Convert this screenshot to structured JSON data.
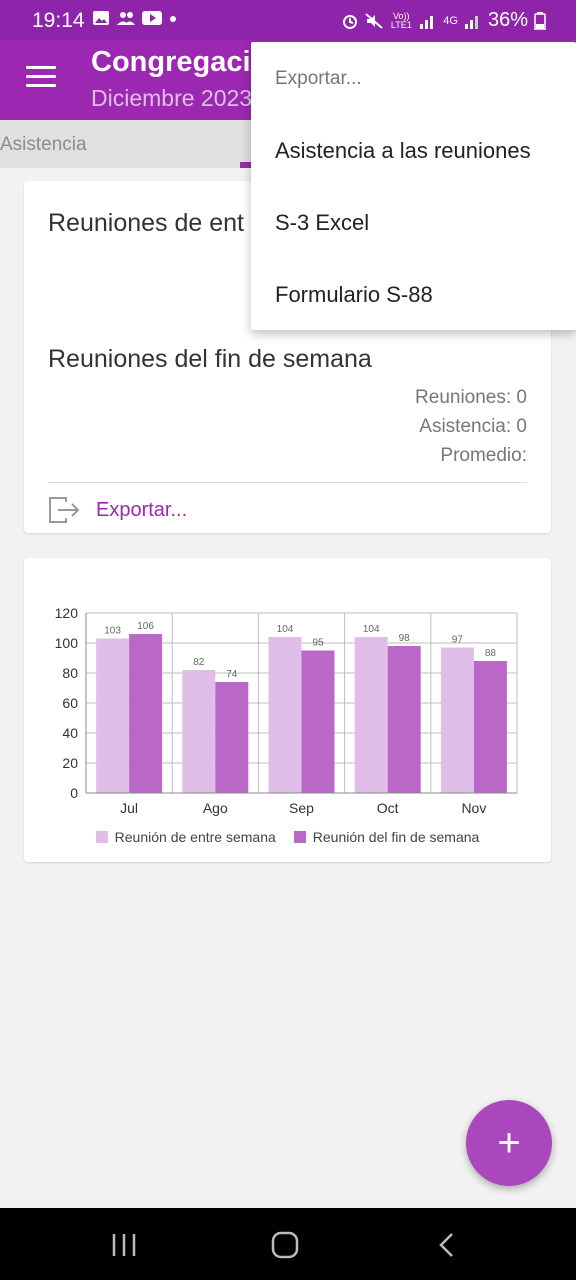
{
  "status_bar": {
    "time": "19:14",
    "battery": "36%",
    "network": "4G",
    "volte": "Vo)) LTE1"
  },
  "app_bar": {
    "title": "Congregacio",
    "subtitle": "Diciembre 2023",
    "color": "#9c27b0"
  },
  "tabs": [
    {
      "label": "Asistencia"
    }
  ],
  "summary_card": {
    "midweek_title": "Reuniones de ent",
    "weekend_title": "Reuniones del fin de semana",
    "meetings": "Reuniones: 0",
    "attendance": "Asistencia: 0",
    "average": "Promedio:",
    "export_label": "Exportar..."
  },
  "export_menu": {
    "header": "Exportar...",
    "items": [
      {
        "label": "Asistencia a las reuniones"
      },
      {
        "label": "S-3 Excel"
      },
      {
        "label": "Formulario S-88"
      }
    ]
  },
  "chart_data": {
    "type": "bar",
    "categories": [
      "Jul",
      "Ago",
      "Sep",
      "Oct",
      "Nov"
    ],
    "series": [
      {
        "name": "Reunión de entre semana",
        "values": [
          103,
          82,
          104,
          104,
          97
        ],
        "color": "#e1bee7"
      },
      {
        "name": "Reunión del fin de semana",
        "values": [
          106,
          74,
          95,
          98,
          88
        ],
        "color": "#ba68c8"
      }
    ],
    "ylim": [
      0,
      120
    ],
    "yticks": [
      0,
      20,
      40,
      60,
      80,
      100,
      120
    ],
    "grid": true,
    "legend": "bottom"
  },
  "fab": {
    "icon": "plus-icon",
    "label": "+"
  },
  "nav": {
    "recent_icon": "recent-apps-icon",
    "home_icon": "home-icon",
    "back_icon": "back-icon"
  }
}
